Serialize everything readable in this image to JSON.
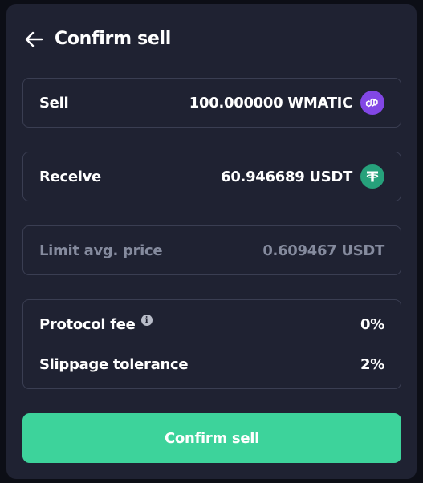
{
  "header": {
    "title": "Confirm sell",
    "back_icon": "arrow-left-icon"
  },
  "sell": {
    "label": "Sell",
    "amount": "100.000000 WMATIC",
    "token_icon": "polygon-matic-icon",
    "token_color": "#8247e5"
  },
  "receive": {
    "label": "Receive",
    "amount": "60.946689 USDT",
    "token_icon": "tether-usdt-icon",
    "token_color": "#26a17b"
  },
  "limit": {
    "label": "Limit avg. price",
    "value": "0.609467 USDT"
  },
  "fees": {
    "protocol_fee_label": "Protocol fee",
    "protocol_fee_value": "0%",
    "info_icon": "info-icon",
    "slippage_label": "Slippage tolerance",
    "slippage_value": "2%"
  },
  "confirm_button": {
    "label": "Confirm sell",
    "color": "#3dd39b"
  }
}
